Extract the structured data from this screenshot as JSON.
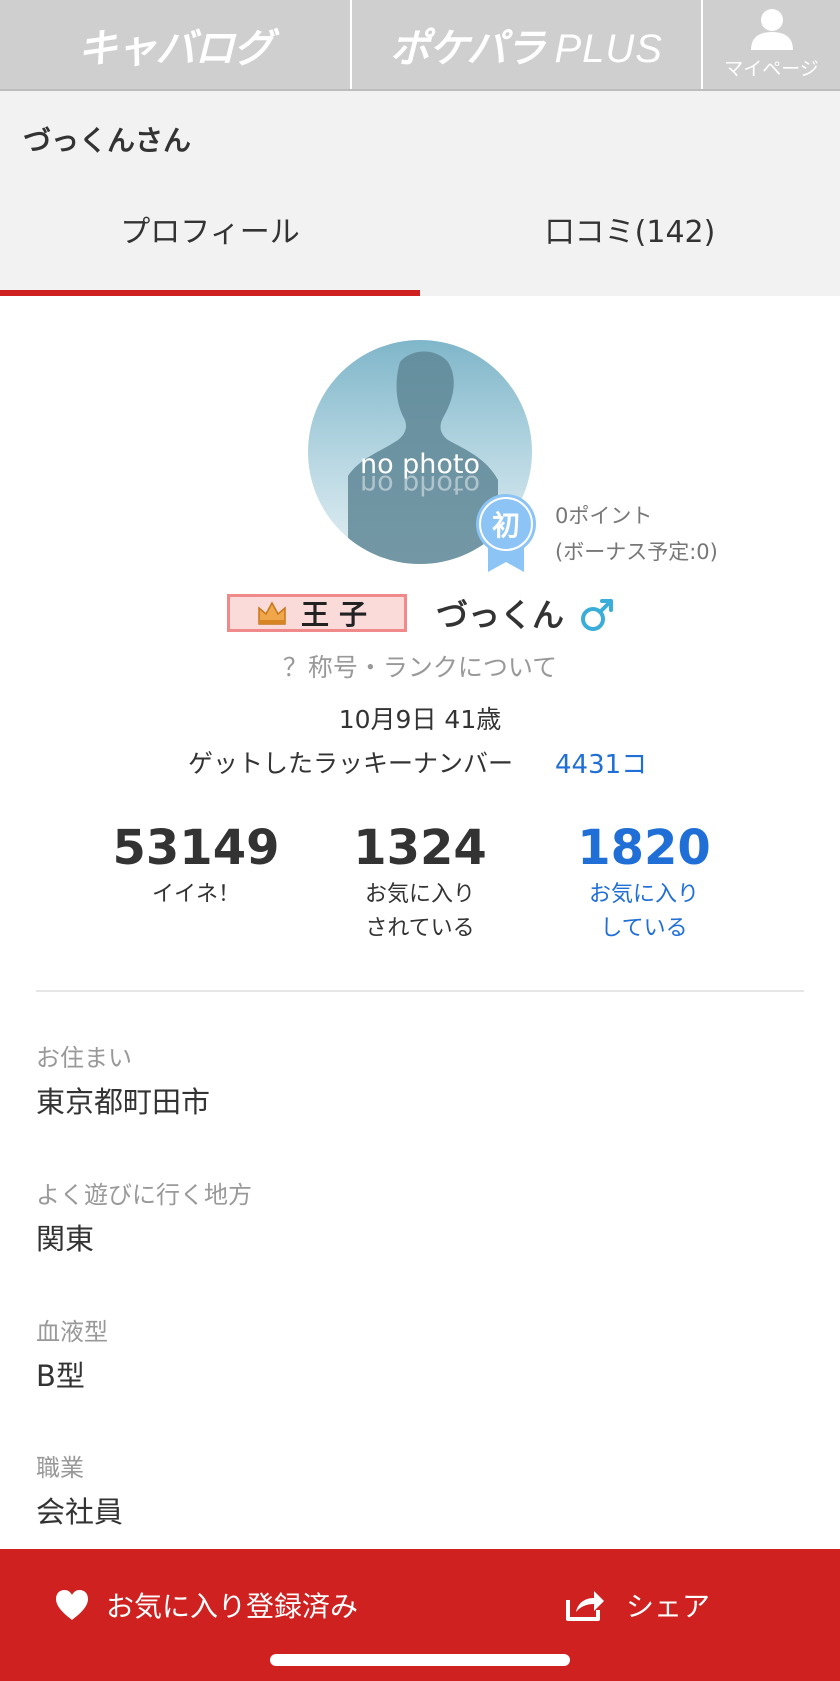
{
  "nav": {
    "logo1": "キャバログ",
    "logo2_main": "ポケパラ",
    "logo2_suffix": "PLUS",
    "mypage": "マイページ"
  },
  "header": {
    "title": "づっくんさん"
  },
  "tabs": [
    {
      "label": "プロフィール",
      "active": true
    },
    {
      "label": "口コミ(142)",
      "active": false
    }
  ],
  "profile": {
    "avatar_text": "no photo",
    "badge_char": "初",
    "points": "0ポイント",
    "bonus": "(ボーナス予定:0)",
    "rank_title": "王子",
    "nickname": "づっくん",
    "rank_link": "？称号・ランクについて",
    "birth": "10月9日 41歳",
    "lucky_label": "ゲットしたラッキーナンバー",
    "lucky_value": "4431コ"
  },
  "stats": [
    {
      "value": "53149",
      "label_line1": "イイネ！",
      "label_line2": ""
    },
    {
      "value": "1324",
      "label_line1": "お気に入り",
      "label_line2": "されている"
    },
    {
      "value": "1820",
      "label_line1": "お気に入り",
      "label_line2": "している"
    }
  ],
  "fields": [
    {
      "label": "お住まい",
      "value": "東京都町田市"
    },
    {
      "label": "よく遊びに行く地方",
      "value": "関東"
    },
    {
      "label": "血液型",
      "value": "B型"
    },
    {
      "label": "職業",
      "value": "会社員"
    }
  ],
  "bottom": {
    "favorite": "お気に入り登録済み",
    "share": "シェア"
  },
  "colors": {
    "accent": "#d02121",
    "link": "#1f6fd6",
    "nav_bg": "#cfcfcf"
  }
}
